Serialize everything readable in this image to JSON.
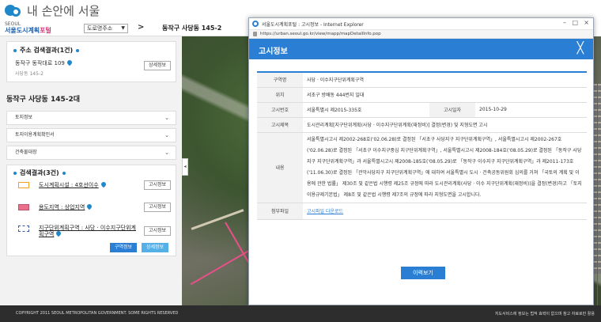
{
  "header": {
    "logo_text": "내 손안에 서울",
    "brand_small": "SEOUL",
    "brand_main": "서울도시계획",
    "brand_suffix": "포털",
    "road_select": "도로명주소",
    "nav_arrow": ">",
    "location_title": "동작구 사당동 145-2"
  },
  "address_results": {
    "title": "주소 검색결과(1건)",
    "road_address": "동작구 동작대로 109",
    "lot_address": "사당동 145-2",
    "detail_button": "상세정보"
  },
  "parcel_heading": "동작구 사당동 145-2대",
  "accordion": [
    {
      "label": "토지정보"
    },
    {
      "label": "토지이용계획확인서"
    },
    {
      "label": "건축물대장"
    }
  ],
  "search_results": {
    "title": "검색결과(3건)",
    "items": [
      {
        "label": "도시계획시설 : 4호선이수",
        "button": "고시정보",
        "color": "#f0a020"
      },
      {
        "label": "용도지역 : 상업지역",
        "button": "고시정보",
        "color": "#e8708a"
      },
      {
        "label": "지구단위계획구역 : 사당 · 이수지구단위계획구역",
        "button": "고시정보",
        "color": "#3a5ab0"
      }
    ],
    "plan_info_button": "구역정보",
    "detail_info_button": "상세정보"
  },
  "popup": {
    "window_title": "서울도시계획포털 : 고시정보 - Internet Explorer",
    "window_controls": [
      "–",
      "□",
      "×"
    ],
    "url": "https://urban.seoul.go.kr/view/mapp/mapDetailInfo.pop",
    "header_title": "고시정보",
    "close_glyph": "╳",
    "rows": {
      "zone_name_label": "구역명",
      "zone_name": "사당 · 이수지구단위계획구역",
      "location_label": "위치",
      "location": "서초구 방배동 444번지 일대",
      "notice_no_label": "고시번호",
      "notice_no": "서울특별시 제2015-335호",
      "notice_date_label": "고시일자",
      "notice_date": "2015-10-29",
      "notice_title_label": "고시제목",
      "notice_title": "도시관리계획[지구단위계획(사당 · 이수지구단위계획(재정비)] 결정(변경) 및 지형도면 고시",
      "content_label": "내용",
      "content": "서울특별시고시 제2002-268호('02.06.28)로 결정된 「서초구 사당지구 지구단위계획구역」, 서울특별시고시 제2002-267호('02.06.28)로 결정된 「서초구 이수지구중심 지구단위계획구역」, 서울특별시고시 제2008-184호('08.05.29)로 결정된 「동작구 사당지구 지구단위계획구역」과 서울특별시고시 제2008-185호('08.05.29)로 「동작구 이수지구 지구단위계획구역」과 제2011-173호('11.06.30)로 결정된 「관악사당지구 지구단위계획구역」에 대하여 서울특별시 도시 · 건축공동위원회 심의를 거쳐 「국토의 계획 및 이용에 관한 법률」 제30조 및 같은법 시행령 제25조 규정에 따라 도시관리계획(사당 · 이수 지구단위계획(재정비))을 결정(변경)하고 「토지이용규제기본법」 제8조 및 같은법 시행령 제7조의 규정에 따라 지형도면을 고시합니다.",
      "attachment_label": "첨부파일",
      "attachment_link": "고시파일 다운로드"
    },
    "history_button": "이력보기"
  },
  "footer": {
    "copyright": "COPYRIGHT 2011 SEOUL METROPOLITAN GOVERNMENT. SOME RIGHTS RESERVED",
    "notice": "지도서비스에 정보는 법적 효력이 없으며 참고 자료로만 활용"
  },
  "colors": {
    "accent": "#2a7fd4",
    "footer_bg": "#2d2d2d"
  }
}
